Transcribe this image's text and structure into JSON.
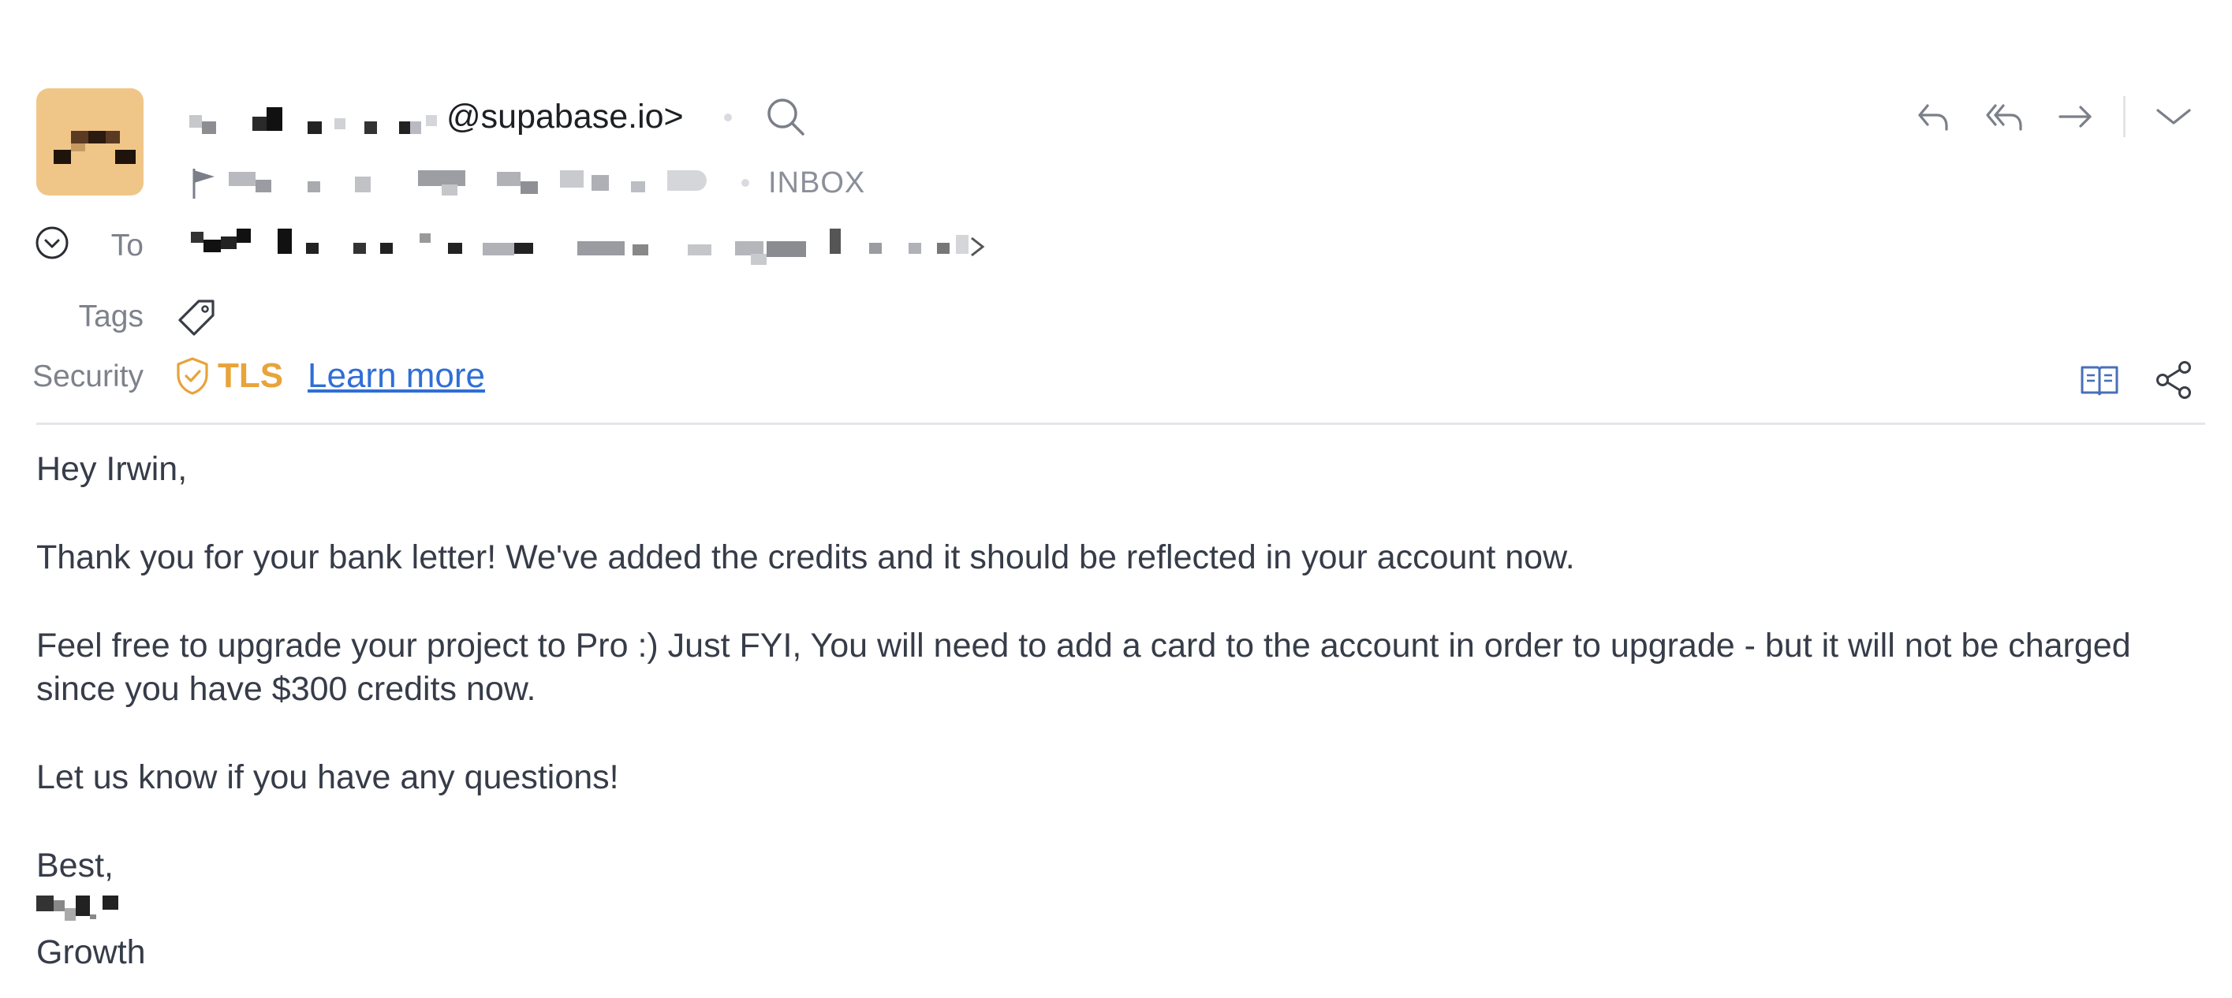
{
  "header": {
    "sender_email_suffix": "@supabase.io>",
    "folder": "INBOX",
    "to_label": "To",
    "tags_label": "Tags",
    "security_label": "Security",
    "tls_label": "TLS",
    "learn_more_label": "Learn more",
    "colors": {
      "avatar_bg": "#f0c688",
      "tls": "#e8a33a",
      "link": "#2f6fd6"
    },
    "icons": [
      "search-icon",
      "reply-icon",
      "reply-all-icon",
      "forward-icon",
      "chevron-down-icon",
      "chevron-down-circle-icon",
      "tag-icon",
      "shield-icon",
      "reader-view-icon",
      "share-icon",
      "flag-icon"
    ]
  },
  "message": {
    "greeting": "Hey Irwin,",
    "paragraph_1": "Thank you for your bank letter! We've added the credits and it should be reflected in your account now.",
    "paragraph_2": "Feel free to upgrade your project to Pro :) Just FYI, You will need to add a card to the account in order to upgrade - but it will not be charged since you have $300 credits now.",
    "paragraph_3": "Let us know if you have any questions!",
    "signoff": "Best,",
    "signature_title": "Growth"
  }
}
